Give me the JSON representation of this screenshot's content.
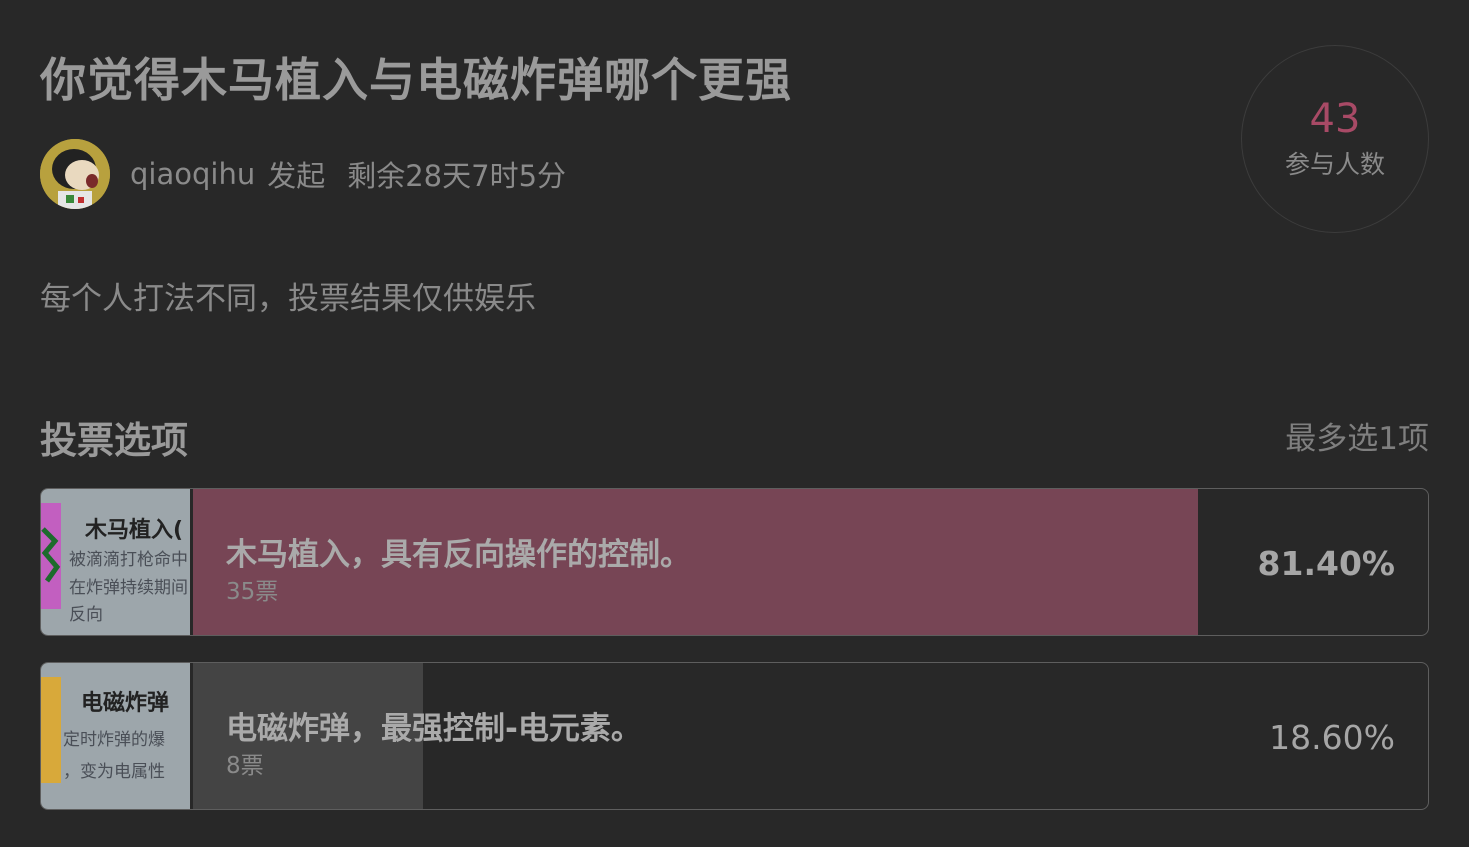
{
  "poll": {
    "title": "你觉得木马植入与电磁炸弹哪个更强",
    "author": "qiaoqihu",
    "author_action": "发起",
    "remaining": "剩余28天7时5分",
    "participants": "43",
    "participants_label": "参与人数",
    "description": "每个人打法不同，投票结果仅供娱乐",
    "section_title": "投票选项",
    "max_select": "最多选1项"
  },
  "options": [
    {
      "thumb_title": "木马植入(",
      "thumb_lines": [
        "被滴滴打枪命中",
        "在炸弹持续期间",
        "反向"
      ],
      "label": "木马植入，具有反向操作的控制。",
      "votes": "35票",
      "percent_text": "81.40%",
      "fraction": 0.814,
      "selected": true
    },
    {
      "thumb_title": "电磁炸弹",
      "thumb_lines": [
        "定时炸弹的爆",
        "，变为电属性"
      ],
      "label": "电磁炸弹，最强控制-电元素。",
      "votes": "8票",
      "percent_text": "18.60%",
      "fraction": 0.186,
      "selected": false
    }
  ],
  "colors": {
    "accent": "#a84a66",
    "selected_bar": "#774555",
    "unselected_bar": "#444444",
    "background": "#282828"
  }
}
